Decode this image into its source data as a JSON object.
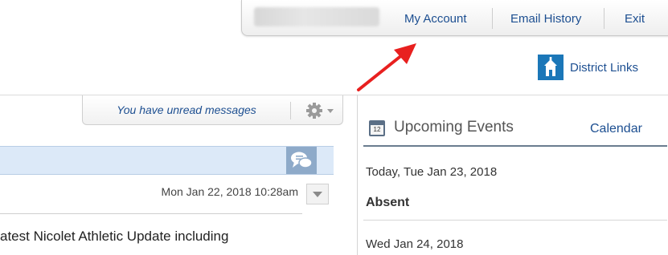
{
  "top_nav": {
    "my_account": "My Account",
    "email_history": "Email History",
    "exit": "Exit"
  },
  "district_links": {
    "label": "District Links",
    "icon": "church-building-icon",
    "color": "#1b77b8"
  },
  "messages": {
    "unread_notice": "You have unread messages",
    "message": {
      "date": "Mon Jan 22, 2018 10:28am",
      "preview": "atest Nicolet Athletic Update including"
    }
  },
  "events": {
    "title": "Upcoming Events",
    "calendar_icon_day": "12",
    "calendar_link": "Calendar",
    "items": [
      {
        "date": "Today, Tue Jan 23, 2018",
        "event": "Absent"
      },
      {
        "date": "Wed Jan 24, 2018"
      }
    ]
  },
  "colors": {
    "link": "#1d4f91",
    "accent": "#1b77b8",
    "header_bg": "#dce9f8",
    "annotation_arrow": "#e8201f"
  }
}
